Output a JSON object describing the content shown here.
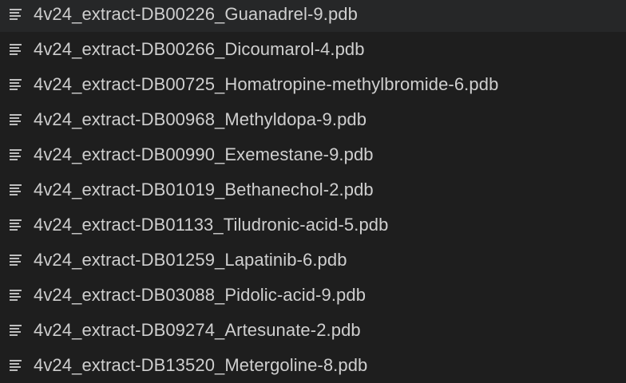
{
  "explorer": {
    "selected_index": 0,
    "files": [
      {
        "name": "4v24_extract-DB00226_Guanadrel-9.pdb",
        "icon": "lines-file-icon"
      },
      {
        "name": "4v24_extract-DB00266_Dicoumarol-4.pdb",
        "icon": "lines-file-icon"
      },
      {
        "name": "4v24_extract-DB00725_Homatropine-methylbromide-6.pdb",
        "icon": "lines-file-icon"
      },
      {
        "name": "4v24_extract-DB00968_Methyldopa-9.pdb",
        "icon": "lines-file-icon"
      },
      {
        "name": "4v24_extract-DB00990_Exemestane-9.pdb",
        "icon": "lines-file-icon"
      },
      {
        "name": "4v24_extract-DB01019_Bethanechol-2.pdb",
        "icon": "lines-file-icon"
      },
      {
        "name": "4v24_extract-DB01133_Tiludronic-acid-5.pdb",
        "icon": "lines-file-icon"
      },
      {
        "name": "4v24_extract-DB01259_Lapatinib-6.pdb",
        "icon": "lines-file-icon"
      },
      {
        "name": "4v24_extract-DB03088_Pidolic-acid-9.pdb",
        "icon": "lines-file-icon"
      },
      {
        "name": "4v24_extract-DB09274_Artesunate-2.pdb",
        "icon": "lines-file-icon"
      },
      {
        "name": "4v24_extract-DB13520_Metergoline-8.pdb",
        "icon": "lines-file-icon"
      }
    ]
  },
  "colors": {
    "background": "#1e1e1e",
    "selected_row": "#262728",
    "text": "#cfcfcf",
    "icon": "#bdbdbd"
  }
}
